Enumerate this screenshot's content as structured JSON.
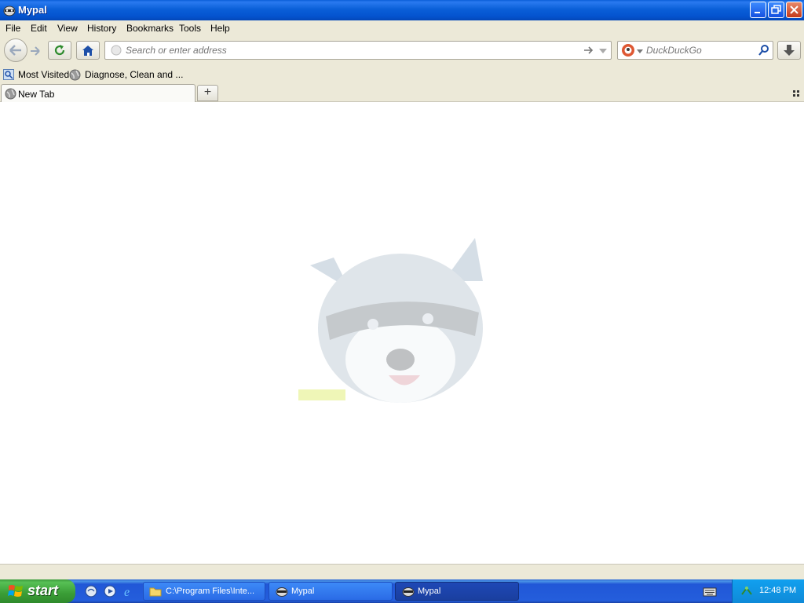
{
  "window": {
    "title": "Mypal"
  },
  "menubar": [
    "File",
    "Edit",
    "View",
    "History",
    "Bookmarks",
    "Tools",
    "Help"
  ],
  "navbar": {
    "address_placeholder": "Search or enter address",
    "search_placeholder": "DuckDuckGo"
  },
  "bookmarks": [
    {
      "label": "Most Visited",
      "icon": "most-visited-icon"
    },
    {
      "label": "Diagnose, Clean and ...",
      "icon": "globe-icon"
    }
  ],
  "tabs": [
    {
      "label": "New Tab",
      "icon": "globe-icon"
    }
  ],
  "taskbar": {
    "start_label": "start",
    "tasks": [
      {
        "label": "C:\\Program Files\\Inte...",
        "icon": "folder-icon"
      },
      {
        "label": "Mypal",
        "icon": "raccoon-icon"
      },
      {
        "label": "Mypal",
        "icon": "raccoon-icon",
        "active": true
      }
    ],
    "clock": "12:48 PM"
  },
  "colors": {
    "titlebar": "#0a5fd8",
    "chrome": "#ece9d8",
    "taskbar": "#245edc",
    "start": "#3a9d36"
  }
}
